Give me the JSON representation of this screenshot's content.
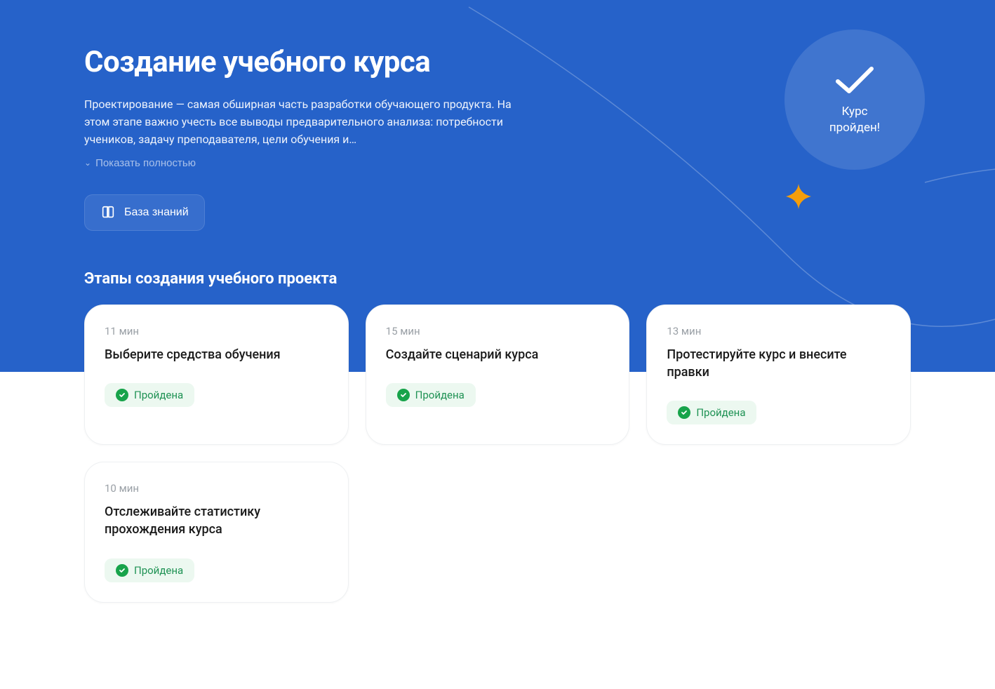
{
  "hero": {
    "title": "Создание учебного курса",
    "description": "Проектирование — самая обширная часть разработки обучающего продукта. На этом этапе важно учесть все выводы предварительного анализа: потребности учеников, задачу преподавателя, цели обучения и…",
    "show_more_label": "Показать полностью",
    "kb_button_label": "База знаний"
  },
  "completion": {
    "line1": "Курс",
    "line2": "пройден!"
  },
  "section_title": "Этапы создания учебного проекта",
  "status_label": "Пройдена",
  "cards": [
    {
      "duration": "11 мин",
      "title": "Выберите средства обучения"
    },
    {
      "duration": "15 мин",
      "title": "Создайте сценарий курса"
    },
    {
      "duration": "13 мин",
      "title": "Протестируйте курс и внесите правки"
    },
    {
      "duration": "10 мин",
      "title": "Отслеживайте статистику прохождения курса"
    }
  ]
}
